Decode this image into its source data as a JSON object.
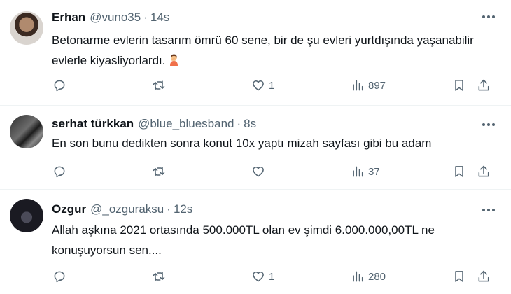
{
  "tweets": [
    {
      "name": "Erhan",
      "handle": "@vuno35",
      "separator": "·",
      "time": "14s",
      "text": "Betonarme evlerin tasarım ömrü 60 sene, bir de şu evleri yurtdışında yaşanabilir evlerle kiyasliyorlardı.",
      "emoji": "woman-facepalming-icon",
      "replies": "",
      "retweets": "",
      "likes": "1",
      "views": "897"
    },
    {
      "name": "serhat türkkan",
      "handle": "@blue_bluesband",
      "separator": "·",
      "time": "8s",
      "text": "En son bunu dedikten sonra konut 10x yaptı mizah sayfası gibi bu adam",
      "replies": "",
      "retweets": "",
      "likes": "",
      "views": "37"
    },
    {
      "name": "Ozgur",
      "handle": "@_ozguraksu",
      "separator": "·",
      "time": "12s",
      "text": "Allah aşkına 2021 ortasında 500.000TL olan  ev şimdi 6.000.000,00TL ne konuşuyorsun sen....",
      "replies": "",
      "retweets": "",
      "likes": "1",
      "views": "280"
    }
  ],
  "colors": {
    "text": "#0f1419",
    "secondary": "#536471",
    "divider": "#eff3f4",
    "background": "#ffffff"
  }
}
